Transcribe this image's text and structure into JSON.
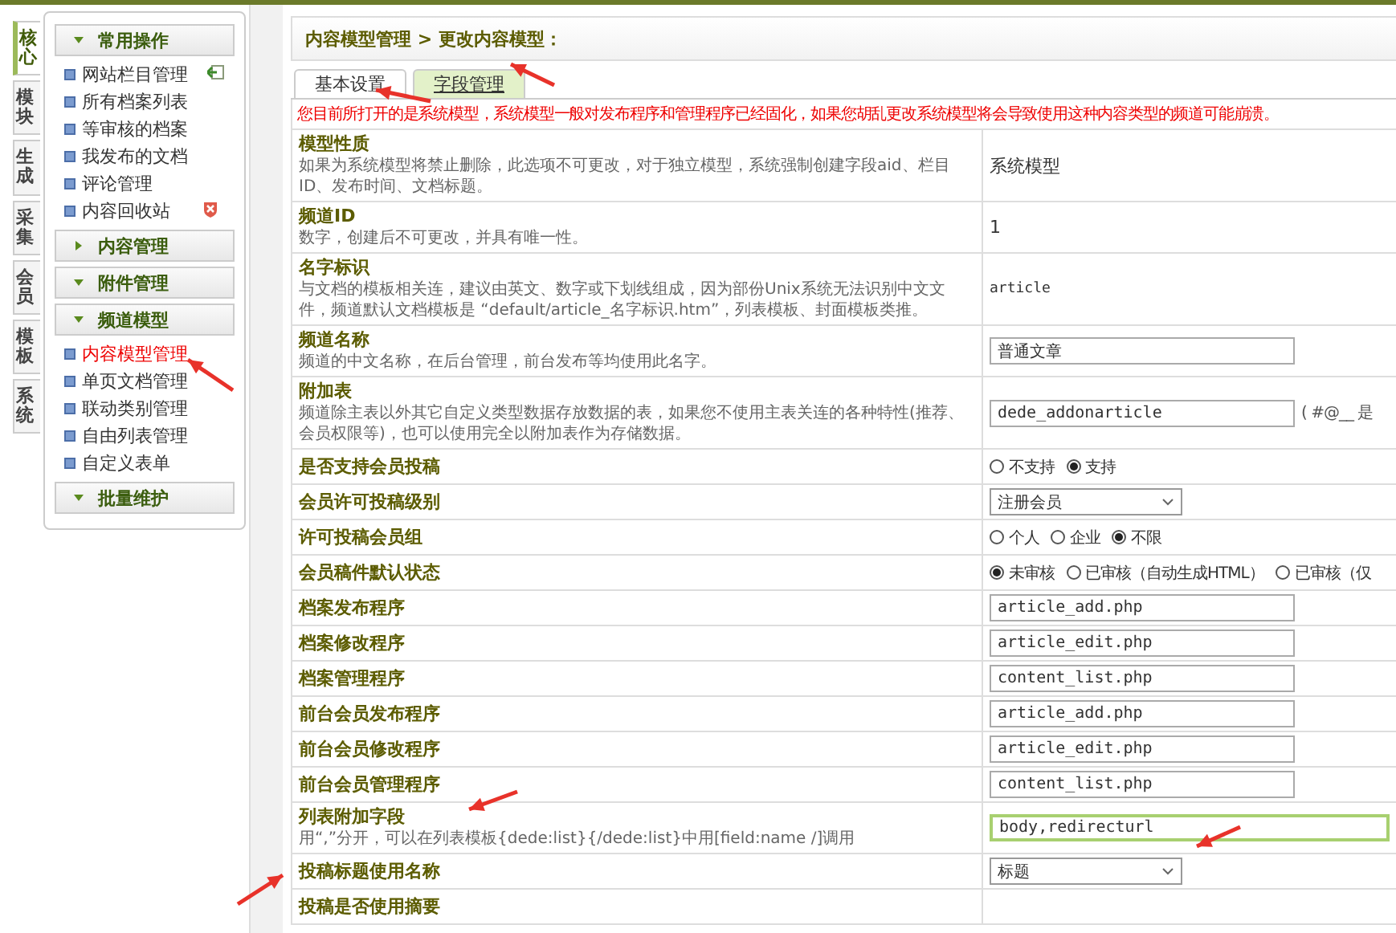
{
  "side_tabs": [
    {
      "label": "核心",
      "selected": true
    },
    {
      "label": "模块",
      "selected": false
    },
    {
      "label": "生成",
      "selected": false
    },
    {
      "label": "采集",
      "selected": false
    },
    {
      "label": "会员",
      "selected": false
    },
    {
      "label": "模板",
      "selected": false
    },
    {
      "label": "系统",
      "selected": false
    }
  ],
  "sidebar": {
    "groups": [
      {
        "title": "常用操作",
        "expanded": true,
        "items": [
          {
            "label": "网站栏目管理",
            "selected": false,
            "kind": "add"
          },
          {
            "label": "所有档案列表",
            "selected": false,
            "kind": "plain"
          },
          {
            "label": "等审核的档案",
            "selected": false,
            "kind": "plain"
          },
          {
            "label": "我发布的文档",
            "selected": false,
            "kind": "plain"
          },
          {
            "label": "评论管理",
            "selected": false,
            "kind": "plain"
          },
          {
            "label": "内容回收站",
            "selected": false,
            "kind": "clear"
          }
        ]
      },
      {
        "title": "内容管理",
        "expanded": false
      },
      {
        "title": "附件管理",
        "expanded": true
      },
      {
        "title": "频道模型",
        "expanded": true,
        "items": [
          {
            "label": "内容模型管理",
            "selected": true,
            "kind": "plain"
          },
          {
            "label": "单页文档管理",
            "selected": false,
            "kind": "plain"
          },
          {
            "label": "联动类别管理",
            "selected": false,
            "kind": "plain"
          },
          {
            "label": "自由列表管理",
            "selected": false,
            "kind": "plain"
          },
          {
            "label": "自定义表单",
            "selected": false,
            "kind": "plain"
          }
        ]
      },
      {
        "title": "批量维护",
        "expanded": true
      }
    ]
  },
  "breadcrumb": "内容模型管理 > 更改内容模型：",
  "tabs": [
    {
      "label": "基本设置",
      "selected": true
    },
    {
      "label": "字段管理",
      "selected": false
    }
  ],
  "notice": "您目前所打开的是系统模型，系统模型一般对发布程序和管理程序已经固化，如果您胡乱更改系统模型将会导致使用这种内容类型的频道可能崩溃。",
  "rows": [
    {
      "label": "模型性质",
      "description": "如果为系统模型将禁止删除，此选项不可更改，对于独立模型，系统强制创建字段aid、栏目ID、发布时间、文档标题。",
      "kind": "text",
      "value": "系统模型"
    },
    {
      "label": "频道ID",
      "description": "数字，创建后不可更改，并具有唯一性。",
      "kind": "text",
      "value": "1"
    },
    {
      "label": "名字标识",
      "description": "与文档的模板相关连，建议由英文、数字或下划线组成，因为部份Unix系统无法识别中文文件，频道默认文档模板是 “default/article_名字标识.htm”，列表模板、封面模板类推。",
      "kind": "text",
      "value": "article"
    },
    {
      "label": "频道名称",
      "description": "频道的中文名称，在后台管理，前台发布等均使用此名字。",
      "kind": "input",
      "value": "普通文章"
    },
    {
      "label": "附加表",
      "description": "频道除主表以外其它自定义类型数据存放数据的表，如果您不使用主表关连的各种特性(推荐、会员权限等)，也可以使用完全以附加表作为存储数据。",
      "kind": "input",
      "value": "dede_addonarticle",
      "note": "( #@__ 是"
    },
    {
      "label": "是否支持会员投稿",
      "kind": "radios",
      "options": [
        {
          "label": "不支持",
          "selected": false
        },
        {
          "label": "支持",
          "selected": true
        }
      ]
    },
    {
      "label": "会员许可投稿级别",
      "kind": "select",
      "value": "注册会员"
    },
    {
      "label": "许可投稿会员组",
      "kind": "radios",
      "options": [
        {
          "label": "个人",
          "selected": false
        },
        {
          "label": "企业",
          "selected": false
        },
        {
          "label": "不限",
          "selected": true
        }
      ]
    },
    {
      "label": "会员稿件默认状态",
      "kind": "radios",
      "options": [
        {
          "label": "未审核",
          "selected": true
        },
        {
          "label": "已审核（自动生成HTML）",
          "selected": false
        },
        {
          "label": "已审核（仅",
          "selected": false
        }
      ]
    },
    {
      "label": "档案发布程序",
      "kind": "input",
      "value": "article_add.php"
    },
    {
      "label": "档案修改程序",
      "kind": "input",
      "value": "article_edit.php"
    },
    {
      "label": "档案管理程序",
      "kind": "input",
      "value": "content_list.php"
    },
    {
      "label": "前台会员发布程序",
      "kind": "input",
      "value": "article_add.php"
    },
    {
      "label": "前台会员修改程序",
      "kind": "input",
      "value": "article_edit.php"
    },
    {
      "label": "前台会员管理程序",
      "kind": "input",
      "value": "content_list.php"
    },
    {
      "label": "列表附加字段",
      "description": "用“,”分开，可以在列表模板{dede:list}{/dede:list}中用[field:name /]调用",
      "kind": "input",
      "value": "body,redirecturl",
      "focused": true
    },
    {
      "label": "投稿标题使用名称",
      "kind": "select",
      "value": "标题"
    },
    {
      "label": "投稿是否使用摘要",
      "kind": "text"
    }
  ]
}
